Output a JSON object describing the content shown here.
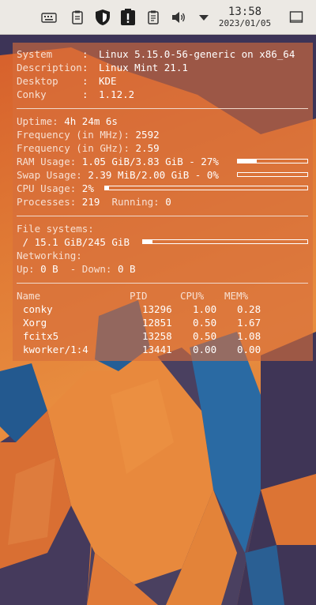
{
  "panel": {
    "tray_icons": [
      "keyboard-icon",
      "clipboard-icon",
      "shield-icon",
      "alert-clipboard-icon",
      "notes-icon",
      "volume-icon",
      "arrow-down-icon"
    ],
    "clock_time": "13:58",
    "clock_date": "2023/01/05",
    "show_desktop_icon": "window-icon"
  },
  "conky": {
    "system": [
      {
        "label": "System",
        "value": "Linux 5.15.0-56-generic on x86_64"
      },
      {
        "label": "Description",
        "value": "Linux Mint 21.1"
      },
      {
        "label": "Desktop",
        "value": "KDE"
      },
      {
        "label": "Conky",
        "value": "1.12.2"
      }
    ],
    "uptime_label": "Uptime:",
    "uptime_value": "4h 24m 6s",
    "freq_mhz_label": "Frequency (in MHz):",
    "freq_mhz_value": "2592",
    "freq_ghz_label": "Frequency (in GHz):",
    "freq_ghz_value": "2.59",
    "ram_label": "RAM Usage:",
    "ram_value": "1.05 GiB/3.83 GiB - 27%",
    "ram_level": 0.27,
    "swap_label": "Swap Usage:",
    "swap_value": "2.39 MiB/2.00 GiB - 0%",
    "swap_level": 0.0,
    "cpu_label": "CPU Usage:",
    "cpu_value": "2%",
    "cpu_level": 0.02,
    "processes_label": "Processes:",
    "processes_value": "219",
    "running_label": "Running:",
    "running_value": "0",
    "fs_label": "File systems:",
    "fs_value": " / 15.1 GiB/245 GiB",
    "fs_level": 0.06,
    "net_label": "Networking:",
    "up_label": "Up:",
    "up_value": "0 B",
    "down_label": "- Down:",
    "down_value": "0 B",
    "proc_headers": {
      "name": "Name",
      "pid": "PID",
      "cpu": "CPU%",
      "mem": "MEM%"
    },
    "processes": [
      {
        "name": "conky",
        "pid": "13296",
        "cpu": "1.00",
        "mem": "0.28"
      },
      {
        "name": "Xorg",
        "pid": "12851",
        "cpu": "0.50",
        "mem": "1.67"
      },
      {
        "name": "fcitx5",
        "pid": "13258",
        "cpu": "0.50",
        "mem": "1.08"
      },
      {
        "name": "kworker/1:4",
        "pid": "13441",
        "cpu": "0.00",
        "mem": "0.00"
      }
    ]
  },
  "colors": {
    "panel_bg": "#ece9e4",
    "wallpaper_orange": "#e0793a",
    "wallpaper_blue": "#2a5f93",
    "wallpaper_purple": "#3d3457"
  }
}
